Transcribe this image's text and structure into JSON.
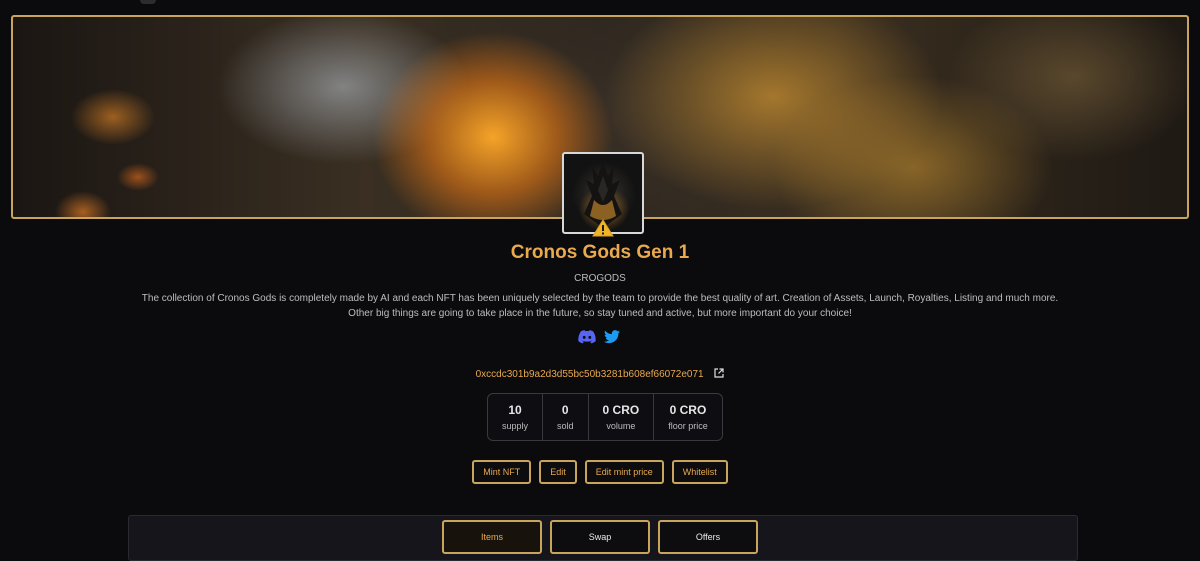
{
  "collection": {
    "title": "Cronos Gods Gen 1",
    "symbol": "CROGODS",
    "description": "The collection of Cronos Gods is completely made by AI and each NFT has been uniquely selected by the team to provide the best quality of art. Creation of Assets, Launch, Royalties, Listing and much more. Other big things are going to take place in the future, so stay tuned and active, but more important do your choice!",
    "address": "0xccdc301b9a2d3d55bc50b3281b608ef66072e071"
  },
  "socials": [
    {
      "name": "discord-icon",
      "color": "#5865f2"
    },
    {
      "name": "twitter-icon",
      "color": "#1d9bf0"
    }
  ],
  "stats": [
    {
      "value": "10",
      "label": "supply"
    },
    {
      "value": "0",
      "label": "sold"
    },
    {
      "value": "0 CRO",
      "label": "volume"
    },
    {
      "value": "0 CRO",
      "label": "floor price"
    }
  ],
  "actions": [
    "Mint NFT",
    "Edit",
    "Edit mint price",
    "Whitelist"
  ],
  "tabs": [
    {
      "label": "Items",
      "active": true
    },
    {
      "label": "Swap",
      "active": false
    },
    {
      "label": "Offers",
      "active": false
    }
  ],
  "colors": {
    "accent": "#e8a94f",
    "border": "#c9a45c",
    "background": "#0b0a0d"
  }
}
